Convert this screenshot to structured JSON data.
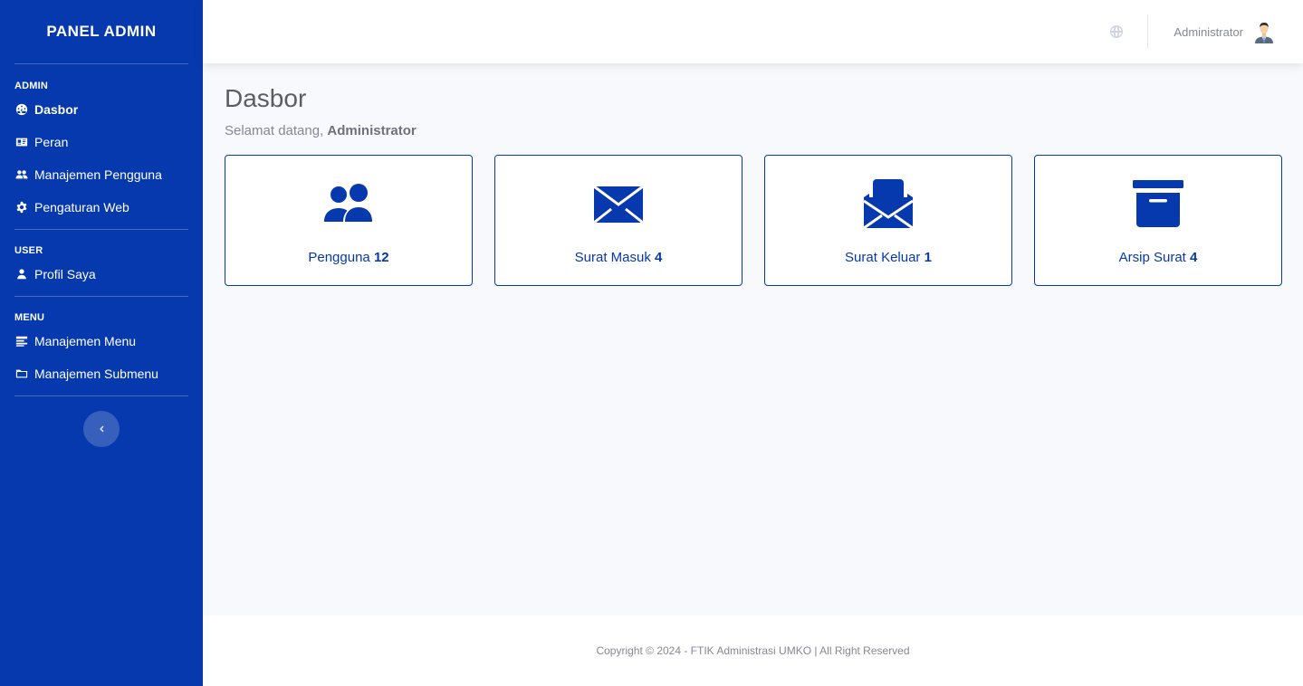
{
  "sidebar": {
    "brand": "PANEL ADMIN",
    "sections": [
      {
        "heading": "ADMIN",
        "items": [
          {
            "label": "Dasbor",
            "icon": "dashboard-gauge-icon"
          },
          {
            "label": "Peran",
            "icon": "id-card-icon"
          },
          {
            "label": "Manajemen Pengguna",
            "icon": "users-icon"
          },
          {
            "label": "Pengaturan Web",
            "icon": "gear-icon"
          }
        ]
      },
      {
        "heading": "USER",
        "items": [
          {
            "label": "Profil Saya",
            "icon": "user-icon"
          }
        ]
      },
      {
        "heading": "MENU",
        "items": [
          {
            "label": "Manajemen Menu",
            "icon": "list-icon"
          },
          {
            "label": "Manajemen Submenu",
            "icon": "folder-icon"
          }
        ]
      }
    ],
    "active_item": "Dasbor",
    "toggle_icon": "chevron-left-icon"
  },
  "topbar": {
    "language_icon": "globe-icon",
    "user_name": "Administrator",
    "avatar_icon": "user-avatar-icon"
  },
  "main": {
    "title": "Dasbor",
    "welcome_prefix": "Selamat datang, ",
    "welcome_name": "Administrator",
    "cards": [
      {
        "label": "Pengguna",
        "count": "12",
        "icon": "users-icon"
      },
      {
        "label": "Surat Masuk",
        "count": "4",
        "icon": "envelope-icon"
      },
      {
        "label": "Surat Keluar",
        "count": "1",
        "icon": "envelope-open-icon"
      },
      {
        "label": "Arsip Surat",
        "count": "4",
        "icon": "archive-box-icon"
      }
    ]
  },
  "footer": {
    "text": "Copyright © 2024 - FTIK Administrasi UMKO | All Right Reserved"
  },
  "colors": {
    "sidebar_bg": "#0539ad",
    "accent": "#0539ad",
    "page_bg": "#f8f9fc"
  }
}
